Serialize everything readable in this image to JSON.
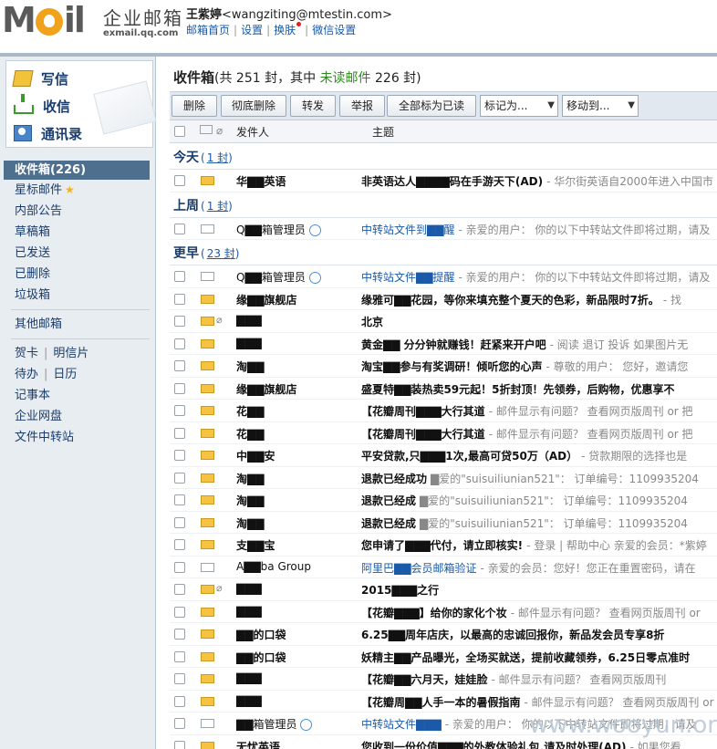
{
  "logo": {
    "brand": "MOil",
    "product": "企业邮箱",
    "domain": "exmail.qq.com"
  },
  "user": {
    "name": "王紫婷",
    "email": "<wangziting@mtestin.com>"
  },
  "top_links": [
    "邮箱首页",
    "设置",
    "换肤",
    "微信设置"
  ],
  "quick": {
    "write": "写信",
    "inbox": "收信",
    "contacts": "通讯录"
  },
  "nav": {
    "inbox": "收件箱(226)",
    "starred": "星标邮件",
    "notice": "内部公告",
    "drafts": "草稿箱",
    "sent": "已发送",
    "deleted": "已删除",
    "spam": "垃圾箱",
    "other": "其他邮箱",
    "card": "贺卡",
    "postcard": "明信片",
    "todo": "待办",
    "calendar": "日历",
    "notes": "记事本",
    "disk": "企业网盘",
    "transfer": "文件中转站"
  },
  "header": {
    "title": "收件箱",
    "summary_pre": "(共 251 封，其中 ",
    "unread_label": "未读邮件",
    "summary_post": " 226 封)"
  },
  "toolbar": {
    "delete": "删除",
    "perm_delete": "彻底删除",
    "forward": "转发",
    "report": "举报",
    "mark_all_read": "全部标为已读",
    "mark_as": "标记为...",
    "move_to": "移动到..."
  },
  "columns": {
    "from": "发件人",
    "subject": "主题"
  },
  "groups": [
    {
      "label": "今天",
      "count": "1 封",
      "rows": [
        {
          "unread": true,
          "env": "new",
          "clip": false,
          "from": "华▇▇英语",
          "subj": "非英语达人▇▇▇▇码在手游天下(AD)",
          "preview": "- 华尔街英语自2000年进入中国市"
        }
      ]
    },
    {
      "label": "上周",
      "count": "1 封",
      "rows": [
        {
          "unread": false,
          "env": "read",
          "clip": false,
          "from": "Q▇▇箱管理员",
          "badge": true,
          "link": true,
          "subj": "中转站文件到▇▇醒",
          "preview": "- 亲爱的用户：  你的以下中转站文件即将过期，请及"
        }
      ]
    },
    {
      "label": "更早",
      "count": "23 封",
      "rows": [
        {
          "unread": false,
          "env": "read",
          "clip": false,
          "from": "Q▇▇箱管理员",
          "badge": true,
          "link": true,
          "subj": "中转站文件▇▇提醒",
          "preview": "- 亲爱的用户：  你的以下中转站文件即将过期，请及"
        },
        {
          "unread": true,
          "env": "new",
          "clip": false,
          "from": "缘▇▇旗舰店",
          "subj": "缘雅可▇▇花园，等你来填充整个夏天的色彩，新品限时7折。",
          "preview": "- 找"
        },
        {
          "unread": true,
          "env": "new",
          "clip": true,
          "from": "▇▇▇",
          "subj": "北京",
          "preview": ""
        },
        {
          "unread": true,
          "env": "new",
          "clip": false,
          "from": "▇▇▇",
          "subj": "黄金▇▇ 分分钟就赚钱！赶紧来开户吧",
          "preview": "- 阅读 退订 投诉 如果图片无"
        },
        {
          "unread": true,
          "env": "new",
          "clip": false,
          "from": "淘▇▇",
          "subj": "淘宝▇▇参与有奖调研！倾听您的心声",
          "preview": "- 尊敬的用户：  您好，邀请您"
        },
        {
          "unread": true,
          "env": "new",
          "clip": false,
          "from": "缘▇▇旗舰店",
          "subj": "盛夏特▇▇装热卖59元起！5折封顶！先领券，后购物，优惠享不",
          "preview": ""
        },
        {
          "unread": true,
          "env": "new",
          "clip": false,
          "from": "花▇▇",
          "subj": "【花瓣周刊▇▇▇大行其道",
          "preview": "- 邮件显示有问题？ 查看网页版周刊 or 把"
        },
        {
          "unread": true,
          "env": "new",
          "clip": false,
          "from": "花▇▇",
          "subj": "【花瓣周刊▇▇▇大行其道",
          "preview": "- 邮件显示有问题？ 查看网页版周刊 or 把"
        },
        {
          "unread": true,
          "env": "new",
          "clip": false,
          "from": "中▇▇安",
          "subj": "平安贷款,只▇▇▇1次,最高可贷50万（AD）",
          "preview": "- 贷款期限的选择也是"
        },
        {
          "unread": true,
          "env": "new",
          "clip": false,
          "from": "淘▇▇",
          "subj": "退款已经成功",
          "preview": "▇爱的\"suisuiliunian521\"：  订单编号：1109935204"
        },
        {
          "unread": true,
          "env": "new",
          "clip": false,
          "from": "淘▇▇",
          "subj": "退款已经成",
          "preview": "▇爱的\"suisuiliunian521\"：  订单编号：1109935204"
        },
        {
          "unread": true,
          "env": "new",
          "clip": false,
          "from": "淘▇▇",
          "subj": "退款已经成",
          "preview": "▇爱的\"suisuiliunian521\"：  订单编号：1109935204"
        },
        {
          "unread": true,
          "env": "new",
          "clip": false,
          "from": "支▇▇宝",
          "subj": "您申请了▇▇▇代付，请立即核实!",
          "preview": "- 登录 | 帮助中心 亲爱的会员：*紫婷"
        },
        {
          "unread": false,
          "env": "read",
          "clip": false,
          "marker": true,
          "from": "A▇▇ba Group",
          "link": true,
          "subj": "阿里巴▇▇会员邮箱验证",
          "preview": "- 亲爱的会员：您好！您正在重置密码，请在"
        },
        {
          "unread": true,
          "env": "new",
          "clip": true,
          "from": "▇▇▇",
          "subj": "2015▇▇▇之行",
          "preview": ""
        },
        {
          "unread": true,
          "env": "new",
          "clip": false,
          "from": "▇▇▇",
          "subj": "【花瓣▇▇▇】给你的家化个妆",
          "preview": "- 邮件显示有问题？ 查看网页版周刊 or"
        },
        {
          "unread": true,
          "env": "new",
          "clip": false,
          "from": "▇▇的口袋",
          "subj": "6.25▇▇周年店庆，以最高的忠诚回报你，新品发会员专享8折",
          "preview": ""
        },
        {
          "unread": true,
          "env": "new",
          "clip": false,
          "from": "▇▇的口袋",
          "subj": "妖精主▇▇产品曝光，全场买就送，提前收藏领券，6.25日零点准时",
          "preview": ""
        },
        {
          "unread": true,
          "env": "new",
          "clip": false,
          "from": "▇▇▇",
          "subj": "【花瓣▇▇六月天，娃娃脸",
          "preview": "- 邮件显示有问题？ 查看网页版周刊"
        },
        {
          "unread": true,
          "env": "new",
          "clip": false,
          "from": "▇▇▇",
          "subj": "【花瓣周▇▇人手一本的暑假指南",
          "preview": "- 邮件显示有问题？ 查看网页版周刊 or"
        },
        {
          "unread": false,
          "env": "read",
          "clip": false,
          "from": "▇▇箱管理员",
          "badge": true,
          "link": true,
          "subj": "中转站文件▇▇▇",
          "preview": "- 亲爱的用户：  你的以下中转站文件即将过期，请及"
        },
        {
          "unread": true,
          "env": "new",
          "clip": false,
          "from": "无忧英语",
          "subj": "您收到一份价值▇▇▇的外教体验礼包,请及时处理(AD)",
          "preview": "- 如果您看"
        }
      ]
    }
  ],
  "watermark": "www.wooyun.org"
}
